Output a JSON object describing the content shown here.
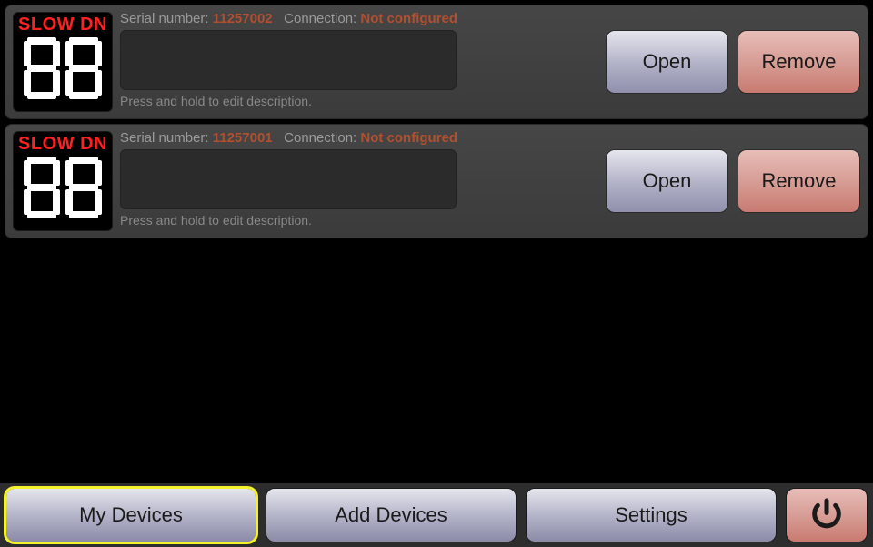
{
  "labels": {
    "serial_prefix": "Serial number: ",
    "conn_prefix": "Connection: ",
    "hint": "Press and hold to edit description.",
    "open": "Open",
    "remove": "Remove",
    "thumb_title": "SLOW DN"
  },
  "devices": [
    {
      "serial": "11257002",
      "connection": "Not configured"
    },
    {
      "serial": "11257001",
      "connection": "Not configured"
    }
  ],
  "tabs": {
    "my_devices": "My Devices",
    "add_devices": "Add Devices",
    "settings": "Settings"
  }
}
